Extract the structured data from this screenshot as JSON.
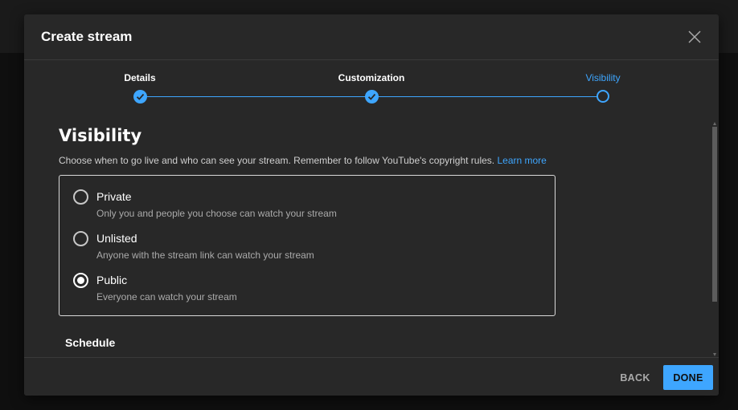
{
  "dialog": {
    "title": "Create stream"
  },
  "stepper": {
    "steps": [
      {
        "label": "Details",
        "state": "done"
      },
      {
        "label": "Customization",
        "state": "done"
      },
      {
        "label": "Visibility",
        "state": "current"
      }
    ]
  },
  "visibility": {
    "title": "Visibility",
    "description": "Choose when to go live and who can see your stream. Remember to follow YouTube's copyright rules.",
    "learn_more": "Learn more",
    "options": [
      {
        "label": "Private",
        "description": "Only you and people you choose can watch your stream",
        "selected": false
      },
      {
        "label": "Unlisted",
        "description": "Anyone with the stream link can watch your stream",
        "selected": false
      },
      {
        "label": "Public",
        "description": "Everyone can watch your stream",
        "selected": true
      }
    ],
    "schedule_label": "Schedule"
  },
  "footer": {
    "back_label": "BACK",
    "done_label": "DONE"
  },
  "colors": {
    "accent": "#3ea6ff",
    "dialog_bg": "#282828",
    "page_bg": "#0f0f0f"
  },
  "icons": {
    "close": "close-icon",
    "step_done": "check-icon",
    "step_current": "ring-icon"
  }
}
